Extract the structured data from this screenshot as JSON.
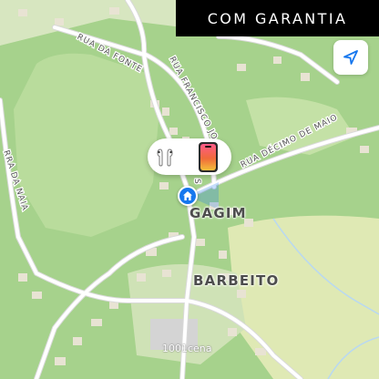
{
  "banner": {
    "text": "COM GARANTIA"
  },
  "locate_button": {
    "icon": "location-arrow-icon"
  },
  "bubble": {
    "icons": [
      "airpods-icon",
      "iphone-icon"
    ]
  },
  "home_pin": {
    "icon": "house-icon",
    "color": "#1677ee"
  },
  "places": {
    "gagim": "GAGIM",
    "barbeito": "BARBEITO"
  },
  "streets": {
    "rua_da_fonte": "RUA DA FONTE",
    "rua_francisco": "RUA FRANCISCO JO",
    "rua_francisco_s": "S",
    "rua_decimo_de_maio": "RUA DÉCIMO DE MAIO",
    "rua_naia": "RRA DA NAIA"
  },
  "poi": {
    "label": "1001cena"
  },
  "colors": {
    "forest": "#a9d48f",
    "meadow": "#dfe9b4",
    "road": "#ffffff",
    "building": "#e9e4d6",
    "accent": "#1677ee"
  }
}
